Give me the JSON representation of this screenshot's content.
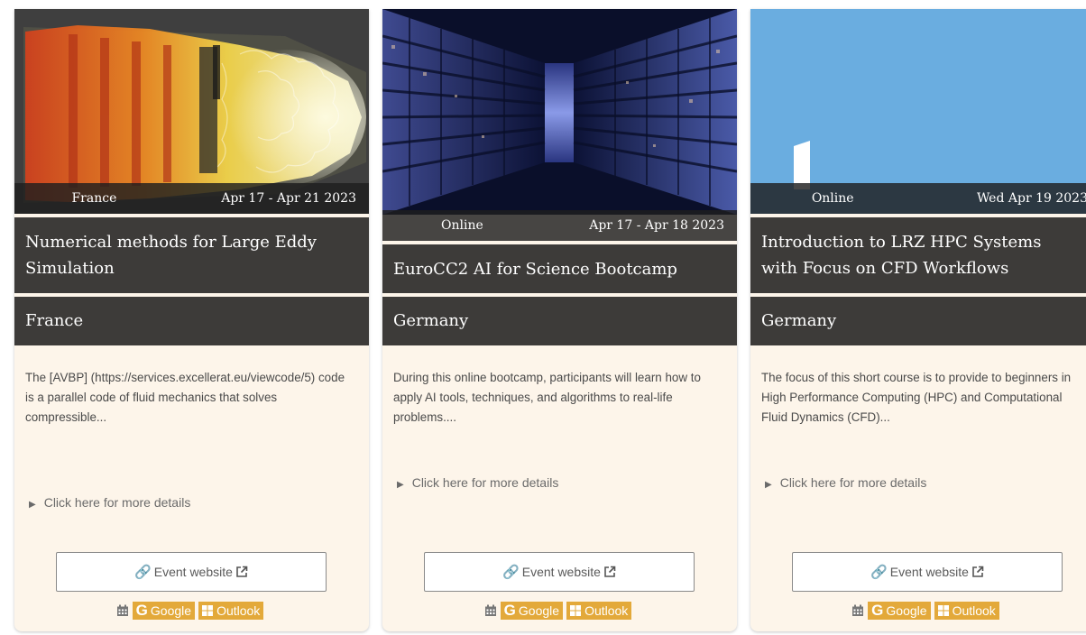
{
  "cards": [
    {
      "location": "France",
      "dates": "Apr 17 - Apr 21 2023",
      "title": "Numerical methods for Large Eddy Simulation",
      "country": "France",
      "description": "The [AVBP] (https://services.excellerat.eu/viewcode/5) code is a parallel code of fluid mechanics that solves compressible...",
      "details_label": "Click here for more details",
      "website_label": "Event website",
      "google_label": "Google",
      "outlook_label": "Outlook"
    },
    {
      "location": "Online",
      "dates": "Apr 17 - Apr 18 2023",
      "title": "EuroCC2 AI for Science Bootcamp",
      "country": "Germany",
      "description": "During this online bootcamp, participants will learn how to apply AI tools, techniques, and algorithms to real-life problems....",
      "details_label": "Click here for more details",
      "website_label": "Event website",
      "google_label": "Google",
      "outlook_label": "Outlook"
    },
    {
      "location": "Online",
      "dates": "Wed Apr 19 2023",
      "title": "Introduction to LRZ HPC Systems with Focus on CFD Workflows",
      "country": "Germany",
      "description": "The focus of this short course is to provide to beginners in High Performance Computing (HPC) and Computational Fluid Dynamics (CFD)...",
      "details_label": "Click here for more details",
      "website_label": "Event website",
      "google_label": "Google",
      "outlook_label": "Outlook"
    }
  ],
  "icons": {
    "link": "link-icon",
    "external": "external-link-icon",
    "calendar": "calendar-icon",
    "google": "google-icon",
    "windows": "windows-icon"
  },
  "colors": {
    "bar_background": "#3d3b39",
    "card_background": "#fdf5ea",
    "calendar_button": "#e3a93a",
    "sky_blue": "#6aade0"
  }
}
